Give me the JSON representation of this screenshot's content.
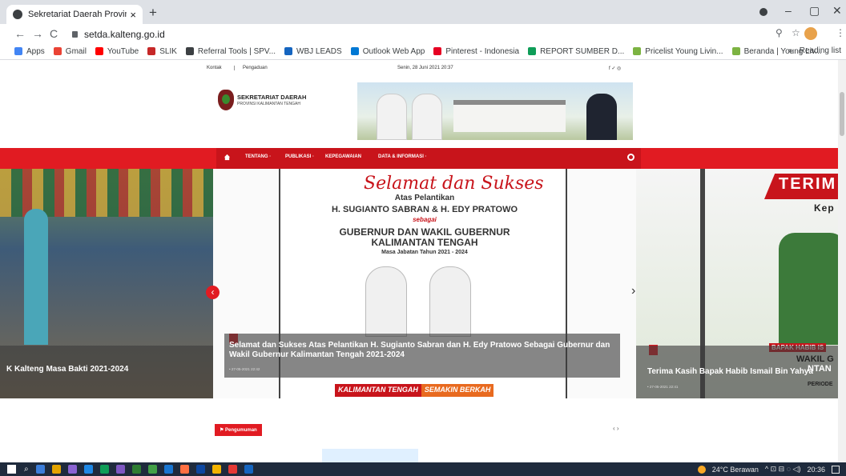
{
  "browser": {
    "tab_title": "Sekretariat Daerah Provinsi Kalim",
    "tab_close": "×",
    "new_tab": "+",
    "url": "setda.kalteng.go.id",
    "window_controls": [
      "–",
      "▢",
      "✕"
    ],
    "nav_icons": [
      "←",
      "→",
      "C"
    ],
    "right_icons": [
      "⚲",
      "☆",
      "⋮"
    ]
  },
  "bookmarks": [
    {
      "label": "Apps",
      "color": "#4285f4"
    },
    {
      "label": "Gmail",
      "color": "#ea4335"
    },
    {
      "label": "YouTube",
      "color": "#ff0000"
    },
    {
      "label": "SLIK",
      "color": "#c62828"
    },
    {
      "label": "Referral Tools | SPV...",
      "color": "#3c4043"
    },
    {
      "label": "WBJ LEADS",
      "color": "#1565c0"
    },
    {
      "label": "Outlook Web App",
      "color": "#0078d4"
    },
    {
      "label": "Pinterest - Indonesia",
      "color": "#e60023"
    },
    {
      "label": "REPORT SUMBER D...",
      "color": "#0f9d58"
    },
    {
      "label": "Pricelist Young Livin...",
      "color": "#7cb342"
    },
    {
      "label": "Beranda | Young Liv...",
      "color": "#7cb342"
    }
  ],
  "bookmarks_more": "»",
  "reading_list": "Reading list",
  "site": {
    "top_links": [
      "Kontak",
      "Pengaduan"
    ],
    "date": "Senin, 28 Juni 2021 20:37",
    "social": "f  ✓  ◎",
    "name": "SEKRETARIAT DAERAH",
    "subname": "PROVINSI KALIMANTAN TENGAH",
    "menu": [
      "TENTANG ·",
      "PUBLIKASI ·",
      "KEPEGAWAIAN",
      "DATA & INFORMASI ·"
    ]
  },
  "slides": {
    "left_caption": "K Kalteng Masa Bakti 2021-2024",
    "center": {
      "script_title": "Selamat dan Sukses",
      "line1": "Atas Pelantikan",
      "line2": "H. SUGIANTO SABRAN  &  H. EDY PRATOWO",
      "line3": "sebagai",
      "line4": "GUBERNUR DAN WAKIL GUBERNUR",
      "line5": "KALIMANTAN TENGAH",
      "line6": "Masa Jabatan Tahun 2021 - 2024",
      "caption": "Selamat dan Sukses Atas Pelantikan H. Sugianto Sabran dan H. Edy Pratowo Sebagai Gubernur dan Wakil Gubernur Kalimantan Tengah 2021-2024",
      "date": "• 27-05-2021 22:42",
      "footer_a": "KALIMANTAN TENGAH",
      "footer_b": "SEMAKIN BERKAH"
    },
    "right": {
      "title": "TERIM",
      "sub": "Kep",
      "caption": "Terima Kasih Bapak Habib Ismail Bin Yahya",
      "date": "• 27-05-2021 22:41",
      "badge": "BAPAK HABIB IS",
      "wakil": "WAKIL G",
      "ntan": "NTAN",
      "periode": "PERIODE"
    },
    "prev": "‹",
    "next": "›"
  },
  "section": {
    "announcement": "Pengumuman",
    "pager": "‹ ›"
  },
  "taskbar": {
    "weather": "24°C  Berawan",
    "tray": "^ ⊡ ⊟ ◌ ◁)",
    "clock": "20:36",
    "icon_colors": [
      "#3c7dd9",
      "#e4a400",
      "#8a63d2",
      "#1e88e5",
      "#0f9d58",
      "#7e57c2",
      "#2e7d32",
      "#43a047",
      "#1976d2",
      "#ff7043",
      "#0d47a1",
      "#f4b400",
      "#e53935",
      "#1565c0"
    ]
  }
}
